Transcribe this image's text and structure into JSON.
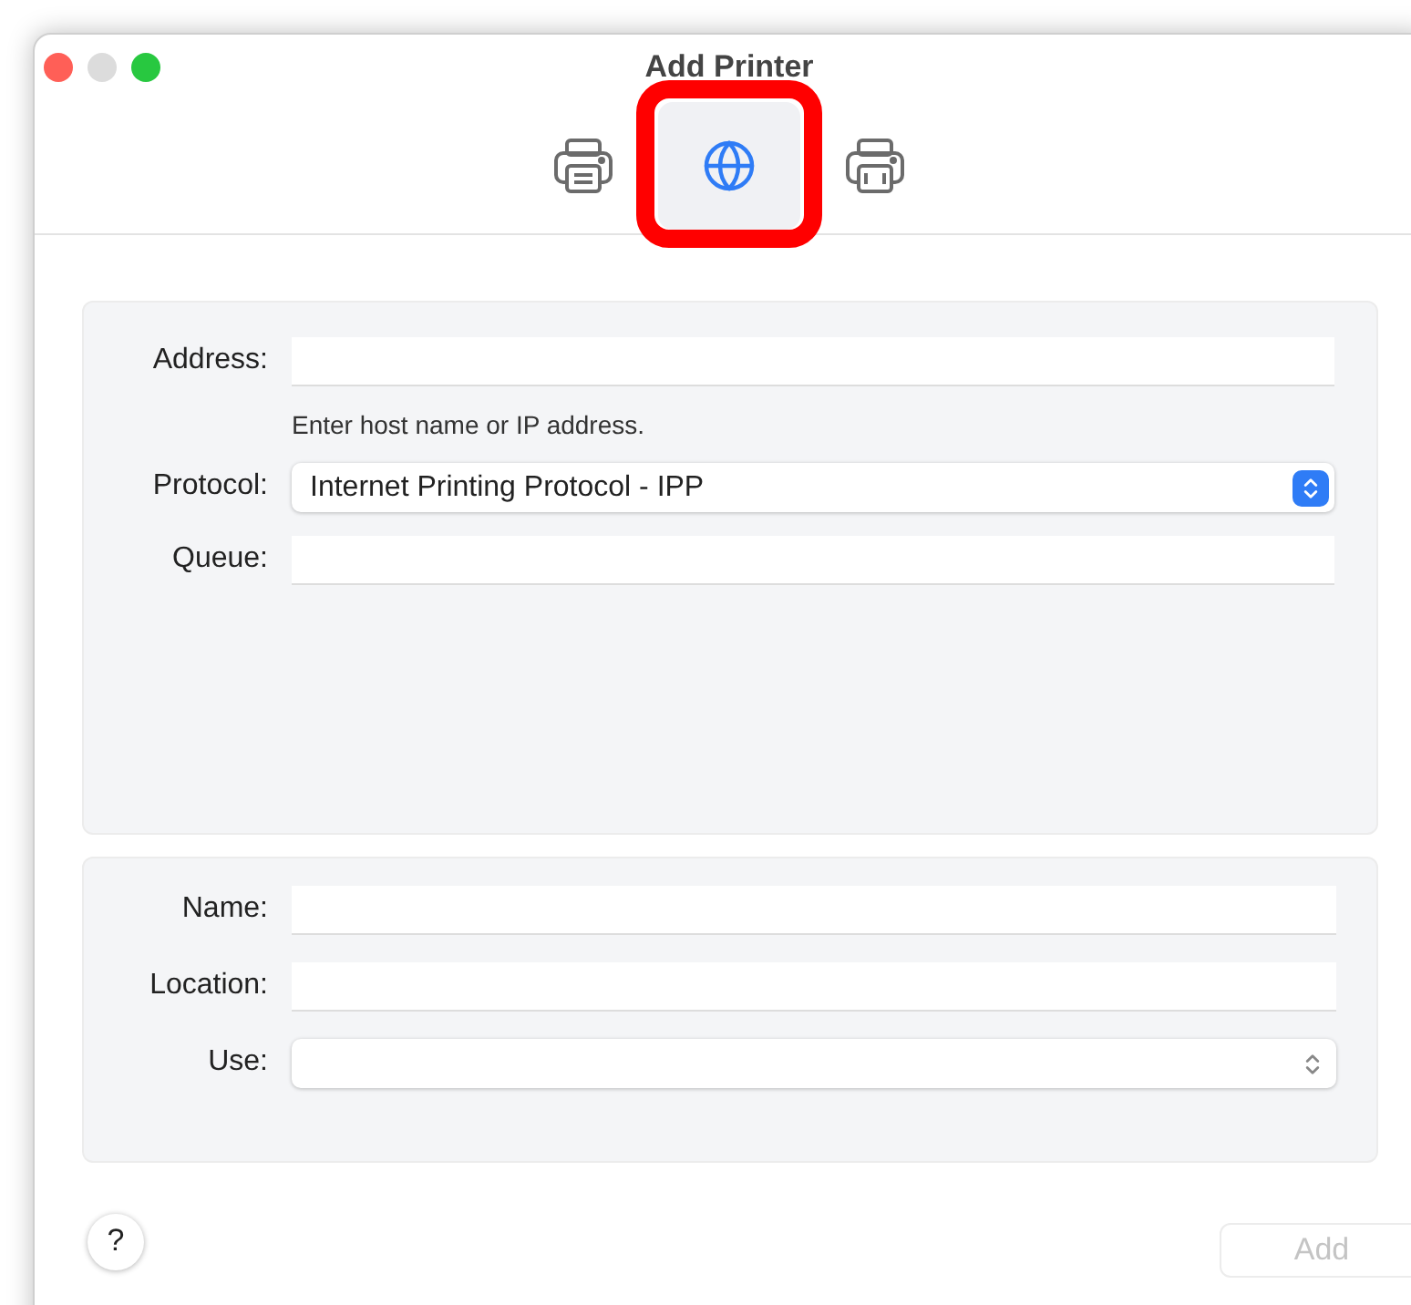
{
  "window": {
    "title": "Add Printer"
  },
  "toolbar": [
    {
      "kind": "printer",
      "selected": false,
      "highlighted": false
    },
    {
      "kind": "globe",
      "selected": true,
      "highlighted": true
    },
    {
      "kind": "fax",
      "selected": false,
      "highlighted": false
    }
  ],
  "address_panel": {
    "fields": [
      {
        "kind": "text",
        "label": "Address:",
        "help_text": "Enter host name or IP address."
      },
      {
        "kind": "popup",
        "label": "Protocol:",
        "value": "Internet Printing Protocol - IPP",
        "disabled": false
      },
      {
        "kind": "text",
        "label": "Queue:"
      }
    ]
  },
  "details_panel": {
    "fields": [
      {
        "kind": "text",
        "label": "Name:"
      },
      {
        "kind": "text",
        "label": "Location:"
      },
      {
        "kind": "popup",
        "label": "Use:",
        "disabled": true
      }
    ]
  },
  "help_button": {
    "label": "?"
  },
  "add_button": {
    "label": "Add",
    "disabled": true
  }
}
